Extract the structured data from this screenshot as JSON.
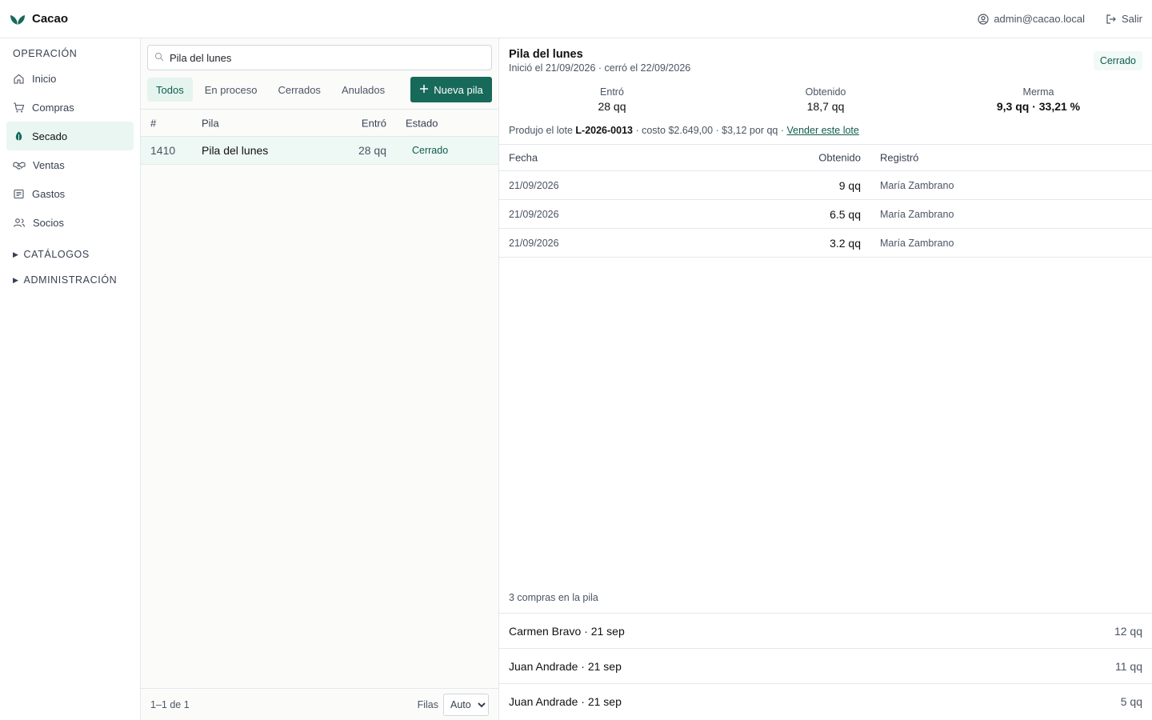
{
  "app": {
    "name": "Cacao"
  },
  "header": {
    "user": "admin@cacao.local",
    "logout": "Salir"
  },
  "sidebar": {
    "section_operacion": "OPERACIÓN",
    "items": [
      {
        "label": "Inicio",
        "icon": "home-icon"
      },
      {
        "label": "Compras",
        "icon": "cart-icon"
      },
      {
        "label": "Secado",
        "icon": "leaf-icon",
        "active": true
      },
      {
        "label": "Ventas",
        "icon": "handshake-icon"
      },
      {
        "label": "Gastos",
        "icon": "receipt-icon"
      },
      {
        "label": "Socios",
        "icon": "users-icon"
      }
    ],
    "groups": [
      {
        "label": "CATÁLOGOS"
      },
      {
        "label": "ADMINISTRACIÓN"
      }
    ]
  },
  "list": {
    "search_value": "Pila del lunes",
    "tabs": [
      "Todos",
      "En proceso",
      "Cerrados",
      "Anulados"
    ],
    "active_tab": "Todos",
    "new_button": "Nueva pila",
    "columns": {
      "id": "#",
      "name": "Pila",
      "in": "Entró",
      "state": "Estado"
    },
    "rows": [
      {
        "id": "1410",
        "name": "Pila del lunes",
        "in": "28 qq",
        "state": "Cerrado"
      }
    ],
    "footer": {
      "range": "1–1 de 1",
      "rows_label": "Filas",
      "rows_value": "Auto"
    }
  },
  "detail": {
    "title": "Pila del lunes",
    "subtitle": "Inició el 21/09/2026 · cerró el 22/09/2026",
    "badge": "Cerrado",
    "stats": [
      {
        "label": "Entró",
        "value": "28 qq"
      },
      {
        "label": "Obtenido",
        "value": "18,7 qq"
      },
      {
        "label": "Merma",
        "value": "9,3 qq · 33,21 %"
      }
    ],
    "lot": {
      "prefix": "Produjo el lote",
      "code": "L-2026-0013",
      "cost": "· costo $2.649,00 · $3,12 por qq ·",
      "link": "Vender este lote"
    },
    "table": {
      "columns": {
        "date": "Fecha",
        "qty": "Obtenido",
        "by": "Registró"
      },
      "rows": [
        {
          "date": "21/09/2026",
          "qty": "9 qq",
          "by": "María Zambrano"
        },
        {
          "date": "21/09/2026",
          "qty": "6.5 qq",
          "by": "María Zambrano"
        },
        {
          "date": "21/09/2026",
          "qty": "3.2 qq",
          "by": "María Zambrano"
        }
      ]
    },
    "purchases_count": "3 compras en la pila",
    "purchases": [
      {
        "name": "Carmen Bravo · 21 sep",
        "qty": "12 qq"
      },
      {
        "name": "Juan Andrade · 21 sep",
        "qty": "11 qq"
      },
      {
        "name": "Juan Andrade · 21 sep",
        "qty": "5 qq"
      }
    ]
  },
  "colors": {
    "accent": "#17695a",
    "accent_text": "#0f5c4d",
    "active_bg": "#eaf6f2"
  }
}
